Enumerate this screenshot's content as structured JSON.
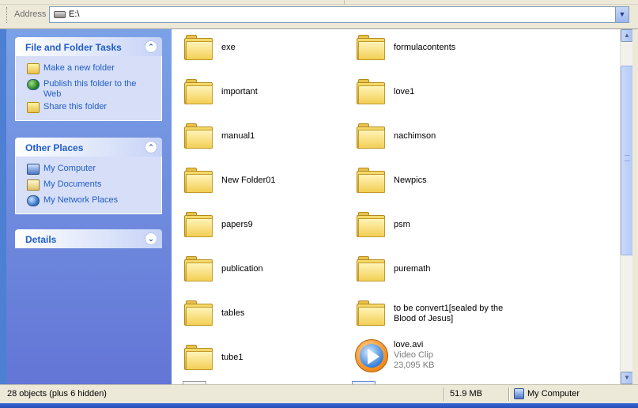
{
  "address": {
    "label": "Address",
    "value": "E:\\"
  },
  "task_pane": {
    "file_folder_tasks": {
      "title": "File and Folder Tasks",
      "items": [
        {
          "label": "Make a new folder",
          "icon": "new-folder-icon"
        },
        {
          "label": "Publish this folder to the Web",
          "icon": "globe-icon"
        },
        {
          "label": "Share this folder",
          "icon": "share-folder-icon"
        }
      ]
    },
    "other_places": {
      "title": "Other Places",
      "items": [
        {
          "label": "My Computer",
          "icon": "my-computer-icon"
        },
        {
          "label": "My Documents",
          "icon": "my-documents-icon"
        },
        {
          "label": "My Network Places",
          "icon": "network-places-icon"
        }
      ]
    },
    "details": {
      "title": "Details"
    }
  },
  "files": [
    {
      "name": "exe",
      "type": "folder"
    },
    {
      "name": "formulacontents",
      "type": "folder"
    },
    {
      "name": "important",
      "type": "folder"
    },
    {
      "name": "love1",
      "type": "folder"
    },
    {
      "name": "manual1",
      "type": "folder"
    },
    {
      "name": "nachimson",
      "type": "folder"
    },
    {
      "name": "New Folder01",
      "type": "folder"
    },
    {
      "name": "Newpics",
      "type": "folder"
    },
    {
      "name": "papers9",
      "type": "folder"
    },
    {
      "name": "psm",
      "type": "folder"
    },
    {
      "name": "publication",
      "type": "folder"
    },
    {
      "name": "puremath",
      "type": "folder"
    },
    {
      "name": "tables",
      "type": "folder"
    },
    {
      "name": "to be convert1[sealed by the Blood of Jesus]",
      "type": "folder"
    },
    {
      "name": "tube1",
      "type": "folder"
    },
    {
      "name": "love.avi",
      "type": "video",
      "kind": "Video Clip",
      "size": "23,095 KB"
    }
  ],
  "status": {
    "objects": "28 objects (plus 6 hidden)",
    "size": "51.9 MB",
    "location": "My Computer"
  },
  "colors": {
    "task_pane_top": "#7ba2e7",
    "task_pane_bottom": "#6375d6",
    "task_link": "#215dc6"
  }
}
